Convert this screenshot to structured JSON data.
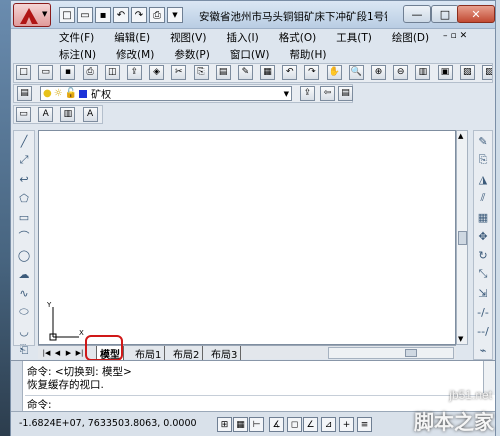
{
  "window": {
    "title": "安徽省池州市马头铜钼矿床下冲矿段1号钼..."
  },
  "menu": {
    "row1": [
      "文件(F)",
      "编辑(E)",
      "视图(V)",
      "插入(I)",
      "格式(O)",
      "工具(T)",
      "绘图(D)"
    ],
    "row2": [
      "标注(N)",
      "修改(M)",
      "参数(P)",
      "窗口(W)",
      "帮助(H)"
    ]
  },
  "layer": {
    "current": "矿权"
  },
  "tabs": {
    "model": "模型",
    "layout1": "布局1",
    "layout2": "布局2",
    "layout3": "布局3"
  },
  "ucs": {
    "x_label": "X",
    "y_label": "Y"
  },
  "command": {
    "line1": "命令:  <切换到: 模型>",
    "line2": "恢复缓存的视口.",
    "prompt": "命令:"
  },
  "status": {
    "coords": "-1.6824E+07,  7633503.8063, 0.0000"
  },
  "watermark": {
    "site": "jb51.net",
    "brand": "脚本之家"
  },
  "colors": {
    "highlight": "#d01818",
    "titlebar": "#c8d9ec"
  }
}
